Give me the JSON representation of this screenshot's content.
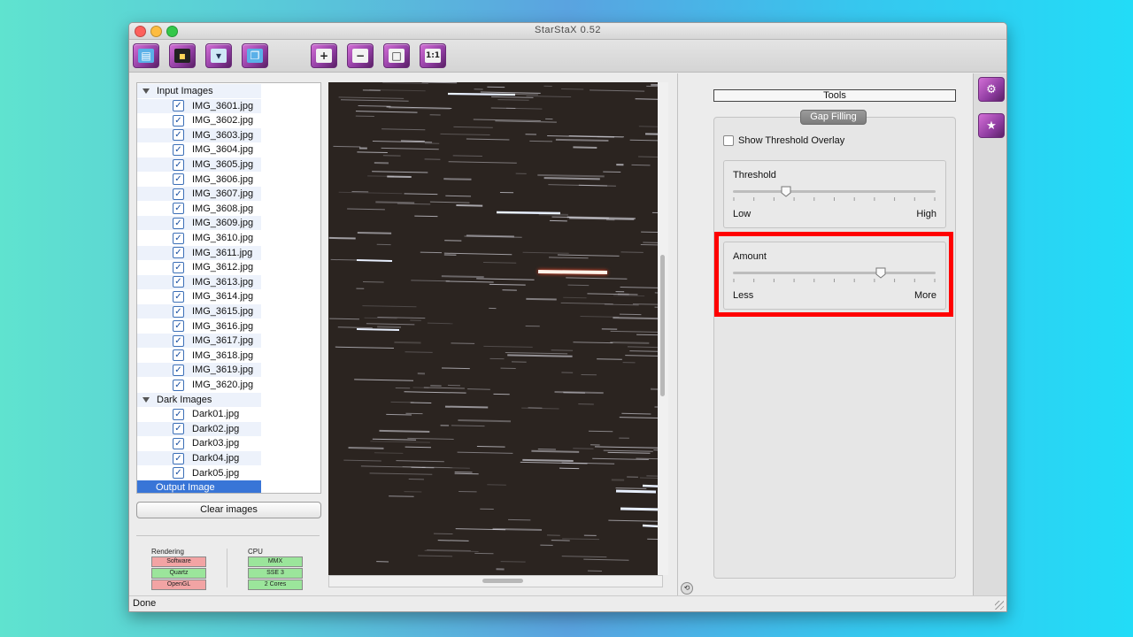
{
  "window": {
    "title": "StarStaX 0.52"
  },
  "toolbar": {
    "buttons": [
      {
        "name": "open-images-button",
        "icon": "folder-icon"
      },
      {
        "name": "open-dark-images-button",
        "icon": "dark-frame-icon"
      },
      {
        "name": "save-image-button",
        "icon": "save-icon"
      },
      {
        "name": "save-all-button",
        "icon": "multi-save-icon"
      },
      {
        "name": "zoom-in-button",
        "icon": "zoom-in-icon"
      },
      {
        "name": "zoom-out-button",
        "icon": "zoom-out-icon"
      },
      {
        "name": "zoom-fit-button",
        "icon": "fit-window-icon"
      },
      {
        "name": "zoom-actual-button",
        "icon": "actual-size-icon",
        "label": "1:1"
      }
    ]
  },
  "tree": {
    "input_label": "Input Images",
    "input_images": [
      "IMG_3601.jpg",
      "IMG_3602.jpg",
      "IMG_3603.jpg",
      "IMG_3604.jpg",
      "IMG_3605.jpg",
      "IMG_3606.jpg",
      "IMG_3607.jpg",
      "IMG_3608.jpg",
      "IMG_3609.jpg",
      "IMG_3610.jpg",
      "IMG_3611.jpg",
      "IMG_3612.jpg",
      "IMG_3613.jpg",
      "IMG_3614.jpg",
      "IMG_3615.jpg",
      "IMG_3616.jpg",
      "IMG_3617.jpg",
      "IMG_3618.jpg",
      "IMG_3619.jpg",
      "IMG_3620.jpg"
    ],
    "dark_label": "Dark Images",
    "dark_images": [
      "Dark01.jpg",
      "Dark02.jpg",
      "Dark03.jpg",
      "Dark04.jpg",
      "Dark05.jpg"
    ],
    "output_label": "Output Image"
  },
  "left": {
    "clear_label": "Clear images",
    "rendering_label": "Rendering",
    "rendering": [
      {
        "label": "Software",
        "status": "red"
      },
      {
        "label": "Quartz",
        "status": "green"
      },
      {
        "label": "OpenGL",
        "status": "red"
      }
    ],
    "cpu_label": "CPU",
    "cpu": [
      {
        "label": "MMX",
        "status": "green"
      },
      {
        "label": "SSE 3",
        "status": "green"
      },
      {
        "label": "2 Cores",
        "status": "green"
      }
    ]
  },
  "tools": {
    "header": "Tools",
    "tab": "Gap Filling",
    "overlay_label": "Show Threshold Overlay",
    "overlay_checked": false,
    "threshold": {
      "label": "Threshold",
      "low": "Low",
      "high": "High",
      "value": 0.26
    },
    "amount": {
      "label": "Amount",
      "low": "Less",
      "high": "More",
      "value": 0.73
    }
  },
  "status": {
    "text": "Done"
  },
  "colors": {
    "selection": "#3875d7",
    "highlight": "#ff0000",
    "accent": "#8f3ca1"
  }
}
